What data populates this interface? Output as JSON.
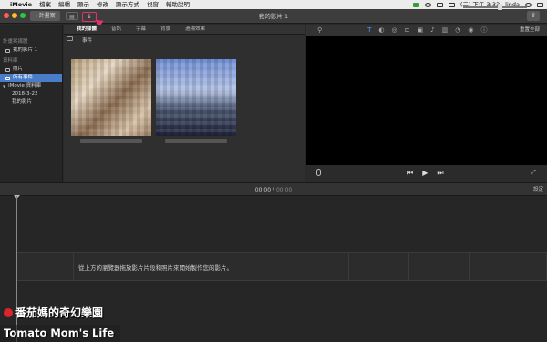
{
  "menubar": {
    "app": "iMovie",
    "items": [
      "檔案",
      "編輯",
      "顯示",
      "修改",
      "顯示方式",
      "視窗",
      "輔助說明"
    ],
    "clock": "(二) 下午 3:33",
    "user": "linda"
  },
  "toolbar": {
    "back_label": "‹ 計畫案",
    "window_title": "我的影片 1",
    "import_icon": "import-arrow-icon"
  },
  "sidebar": {
    "section1": "計畫案媒體",
    "item_project": "我的影片 1",
    "section2": "資料庫",
    "item_photos": "照片",
    "item_all_events": "所有事件",
    "library": "iMovie 資料庫",
    "event_date": "2018-3-22",
    "event_movie": "我的影片"
  },
  "browser": {
    "tabs": [
      "我的媒體",
      "音訊",
      "字幕",
      "背景",
      "過場效果"
    ],
    "active_tab": "我的媒體",
    "event_label": "事件"
  },
  "viewer": {
    "reset_label": "重置全部"
  },
  "timeline": {
    "current": "00:00",
    "separator": "/",
    "total": "00:00",
    "settings_label": "設定",
    "drop_hint": "從上方的瀏覽器拖放影片片段和照片來開始製作您的影片。"
  },
  "watermark": {
    "cn": "番茄媽的奇幻樂園",
    "en": "Tomato Mom's Life"
  }
}
